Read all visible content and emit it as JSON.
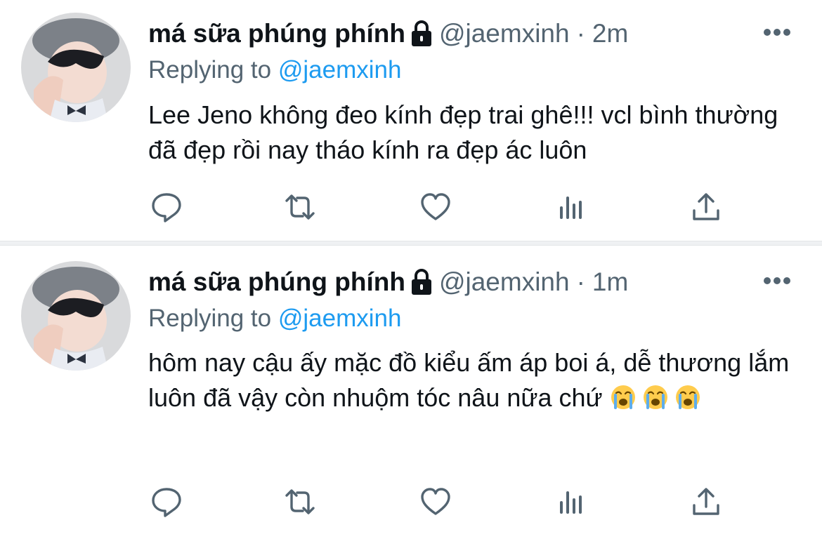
{
  "tweets": [
    {
      "display_name": "má sữa phúng phính",
      "handle": "@jaemxinh",
      "dot": "·",
      "time": "2m",
      "replying_prefix": "Replying to",
      "replying_mention": "@jaemxinh",
      "text": "Lee Jeno không đeo kính đẹp trai ghê!!! vcl bình thường đã đẹp rồi nay tháo kính ra đẹp ác luôn",
      "emojis": []
    },
    {
      "display_name": "má sữa phúng phính",
      "handle": "@jaemxinh",
      "dot": "·",
      "time": "1m",
      "replying_prefix": "Replying to",
      "replying_mention": "@jaemxinh",
      "text": "hôm nay cậu ấy mặc đồ kiểu ấm áp boi á, dễ thương lắm luôn đã vậy còn nhuộm tóc nâu nữa chứ",
      "emojis": [
        "loudly-crying-face",
        "loudly-crying-face",
        "loudly-crying-face"
      ]
    }
  ],
  "icons": {
    "verified_lock": "lock-icon",
    "more": "more-icon",
    "reply": "reply-icon",
    "retweet": "retweet-icon",
    "like": "heart-icon",
    "stats": "analytics-icon",
    "share": "share-icon"
  },
  "colors": {
    "text": "#0f1419",
    "secondary": "#536471",
    "link": "#1d9bf0",
    "divider": "#eff1f3"
  }
}
